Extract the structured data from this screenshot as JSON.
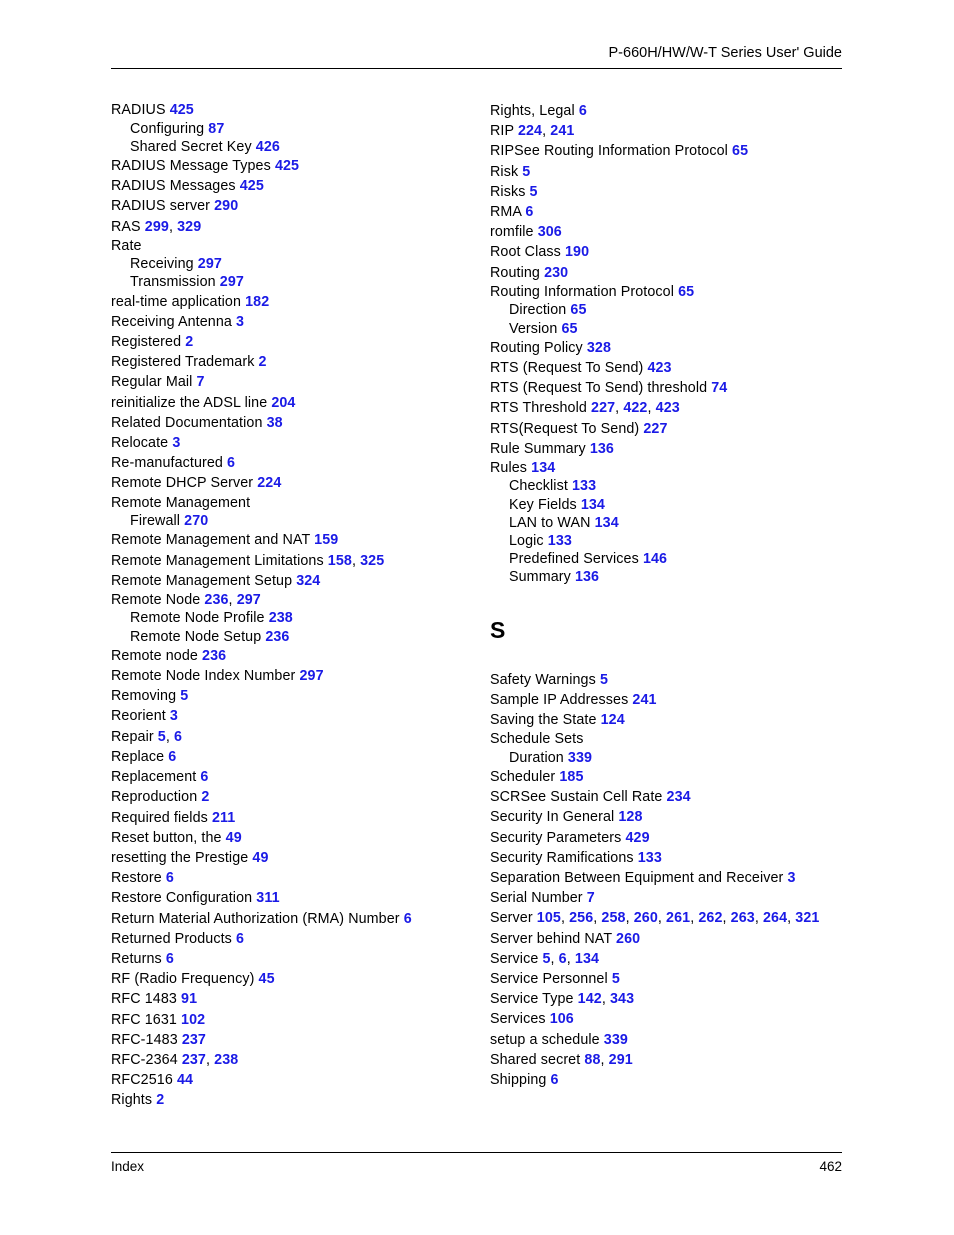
{
  "header": {
    "title": "P-660H/HW/W-T Series User' Guide"
  },
  "footer": {
    "label": "Index",
    "page_number": "462"
  },
  "colors": {
    "page_number_blue": "#1a1ae6",
    "text_black": "#000000"
  },
  "columns": {
    "left": [
      {
        "text": "RADIUS",
        "pages": [
          "425"
        ],
        "level": 0
      },
      {
        "text": "Configuring",
        "pages": [
          "87"
        ],
        "level": 1
      },
      {
        "text": "Shared Secret Key",
        "pages": [
          "426"
        ],
        "level": 1
      },
      {
        "text": "RADIUS Message Types",
        "pages": [
          "425"
        ],
        "level": 0
      },
      {
        "text": "RADIUS Messages",
        "pages": [
          "425"
        ],
        "level": 0
      },
      {
        "text": "RADIUS server",
        "pages": [
          "290"
        ],
        "level": 0
      },
      {
        "text": "RAS",
        "pages": [
          "299",
          "329"
        ],
        "level": 0
      },
      {
        "text": "Rate",
        "pages": [],
        "level": 0
      },
      {
        "text": "Receiving",
        "pages": [
          "297"
        ],
        "level": 1
      },
      {
        "text": "Transmission",
        "pages": [
          "297"
        ],
        "level": 1
      },
      {
        "text": "real-time application",
        "pages": [
          "182"
        ],
        "level": 0
      },
      {
        "text": "Receiving Antenna",
        "pages": [
          "3"
        ],
        "level": 0
      },
      {
        "text": "Registered",
        "pages": [
          "2"
        ],
        "level": 0
      },
      {
        "text": "Registered Trademark",
        "pages": [
          "2"
        ],
        "level": 0
      },
      {
        "text": "Regular Mail",
        "pages": [
          "7"
        ],
        "level": 0
      },
      {
        "text": "reinitialize the ADSL line",
        "pages": [
          "204"
        ],
        "level": 0
      },
      {
        "text": "Related Documentation",
        "pages": [
          "38"
        ],
        "level": 0
      },
      {
        "text": "Relocate",
        "pages": [
          "3"
        ],
        "level": 0
      },
      {
        "text": "Re-manufactured",
        "pages": [
          "6"
        ],
        "level": 0
      },
      {
        "text": "Remote DHCP Server",
        "pages": [
          "224"
        ],
        "level": 0
      },
      {
        "text": "Remote Management",
        "pages": [],
        "level": 0
      },
      {
        "text": "Firewall",
        "pages": [
          "270"
        ],
        "level": 1
      },
      {
        "text": "Remote Management and NAT",
        "pages": [
          "159"
        ],
        "level": 0
      },
      {
        "text": "Remote Management Limitations",
        "pages": [
          "158",
          "325"
        ],
        "level": 0
      },
      {
        "text": "Remote Management Setup",
        "pages": [
          "324"
        ],
        "level": 0
      },
      {
        "text": "Remote Node",
        "pages": [
          "236",
          "297"
        ],
        "level": 0
      },
      {
        "text": "Remote Node Profile",
        "pages": [
          "238"
        ],
        "level": 1
      },
      {
        "text": "Remote Node Setup",
        "pages": [
          "236"
        ],
        "level": 1
      },
      {
        "text": "Remote node",
        "pages": [
          "236"
        ],
        "level": 0
      },
      {
        "text": "Remote Node Index Number",
        "pages": [
          "297"
        ],
        "level": 0
      },
      {
        "text": "Removing",
        "pages": [
          "5"
        ],
        "level": 0
      },
      {
        "text": "Reorient",
        "pages": [
          "3"
        ],
        "level": 0
      },
      {
        "text": "Repair",
        "pages": [
          "5",
          "6"
        ],
        "level": 0
      },
      {
        "text": "Replace",
        "pages": [
          "6"
        ],
        "level": 0
      },
      {
        "text": "Replacement",
        "pages": [
          "6"
        ],
        "level": 0
      },
      {
        "text": "Reproduction",
        "pages": [
          "2"
        ],
        "level": 0
      },
      {
        "text": "Required fields",
        "pages": [
          "211"
        ],
        "level": 0
      },
      {
        "text": "Reset button, the",
        "pages": [
          "49"
        ],
        "level": 0
      },
      {
        "text": "resetting the Prestige",
        "pages": [
          "49"
        ],
        "level": 0
      },
      {
        "text": "Restore",
        "pages": [
          "6"
        ],
        "level": 0
      },
      {
        "text": "Restore Configuration",
        "pages": [
          "311"
        ],
        "level": 0
      },
      {
        "text": "Return Material Authorization (RMA) Number",
        "pages": [
          "6"
        ],
        "level": 0
      },
      {
        "text": "Returned Products",
        "pages": [
          "6"
        ],
        "level": 0
      },
      {
        "text": "Returns",
        "pages": [
          "6"
        ],
        "level": 0
      },
      {
        "text": "RF (Radio Frequency)",
        "pages": [
          "45"
        ],
        "level": 0
      },
      {
        "text": "RFC 1483",
        "pages": [
          "91"
        ],
        "level": 0
      },
      {
        "text": "RFC 1631",
        "pages": [
          "102"
        ],
        "level": 0
      },
      {
        "text": "RFC-1483",
        "pages": [
          "237"
        ],
        "level": 0
      },
      {
        "text": "RFC-2364",
        "pages": [
          "237",
          "238"
        ],
        "level": 0
      },
      {
        "text": "RFC2516",
        "pages": [
          "44"
        ],
        "level": 0
      },
      {
        "text": "Rights",
        "pages": [
          "2"
        ],
        "level": 0
      }
    ],
    "right_before_letter": [
      {
        "text": "Rights, Legal",
        "pages": [
          "6"
        ],
        "level": 0
      },
      {
        "text": "RIP",
        "pages": [
          "224",
          "241"
        ],
        "level": 0
      },
      {
        "text": "RIPSee Routing Information Protocol",
        "pages": [
          "65"
        ],
        "level": 0
      },
      {
        "text": "Risk",
        "pages": [
          "5"
        ],
        "level": 0
      },
      {
        "text": "Risks",
        "pages": [
          "5"
        ],
        "level": 0
      },
      {
        "text": "RMA",
        "pages": [
          "6"
        ],
        "level": 0
      },
      {
        "text": "romfile",
        "pages": [
          "306"
        ],
        "level": 0
      },
      {
        "text": "Root Class",
        "pages": [
          "190"
        ],
        "level": 0
      },
      {
        "text": "Routing",
        "pages": [
          "230"
        ],
        "level": 0
      },
      {
        "text": "Routing Information Protocol",
        "pages": [
          "65"
        ],
        "level": 0
      },
      {
        "text": "Direction",
        "pages": [
          "65"
        ],
        "level": 1
      },
      {
        "text": "Version",
        "pages": [
          "65"
        ],
        "level": 1
      },
      {
        "text": "Routing Policy",
        "pages": [
          "328"
        ],
        "level": 0
      },
      {
        "text": "RTS (Request To Send)",
        "pages": [
          "423"
        ],
        "level": 0
      },
      {
        "text": "RTS (Request To Send) threshold",
        "pages": [
          "74"
        ],
        "level": 0
      },
      {
        "text": "RTS Threshold",
        "pages": [
          "227",
          "422",
          "423"
        ],
        "level": 0
      },
      {
        "text": "RTS(Request To Send)",
        "pages": [
          "227"
        ],
        "level": 0
      },
      {
        "text": "Rule Summary",
        "pages": [
          "136"
        ],
        "level": 0
      },
      {
        "text": "Rules",
        "pages": [
          "134"
        ],
        "level": 0
      },
      {
        "text": "Checklist",
        "pages": [
          "133"
        ],
        "level": 1
      },
      {
        "text": "Key Fields",
        "pages": [
          "134"
        ],
        "level": 1
      },
      {
        "text": "LAN to WAN",
        "pages": [
          "134"
        ],
        "level": 1
      },
      {
        "text": "Logic",
        "pages": [
          "133"
        ],
        "level": 1
      },
      {
        "text": "Predefined Services",
        "pages": [
          "146"
        ],
        "level": 1
      },
      {
        "text": "Summary",
        "pages": [
          "136"
        ],
        "level": 1
      }
    ],
    "letter_heading": "S",
    "right_after_letter": [
      {
        "text": "Safety Warnings",
        "pages": [
          "5"
        ],
        "level": 0
      },
      {
        "text": "Sample IP Addresses",
        "pages": [
          "241"
        ],
        "level": 0
      },
      {
        "text": "Saving the State",
        "pages": [
          "124"
        ],
        "level": 0
      },
      {
        "text": "Schedule Sets",
        "pages": [],
        "level": 0
      },
      {
        "text": "Duration",
        "pages": [
          "339"
        ],
        "level": 1
      },
      {
        "text": "Scheduler",
        "pages": [
          "185"
        ],
        "level": 0
      },
      {
        "text": "SCRSee Sustain Cell Rate",
        "pages": [
          "234"
        ],
        "level": 0
      },
      {
        "text": "Security In General",
        "pages": [
          "128"
        ],
        "level": 0
      },
      {
        "text": "Security Parameters",
        "pages": [
          "429"
        ],
        "level": 0
      },
      {
        "text": "Security Ramifications",
        "pages": [
          "133"
        ],
        "level": 0
      },
      {
        "text": "Separation Between Equipment and Receiver",
        "pages": [
          "3"
        ],
        "level": 0
      },
      {
        "text": "Serial Number",
        "pages": [
          "7"
        ],
        "level": 0
      },
      {
        "text": "Server",
        "pages": [
          "105",
          "256",
          "258",
          "260",
          "261",
          "262",
          "263",
          "264",
          "321"
        ],
        "level": 0
      },
      {
        "text": "Server behind NAT",
        "pages": [
          "260"
        ],
        "level": 0
      },
      {
        "text": "Service",
        "pages": [
          "5",
          "6",
          "134"
        ],
        "level": 0
      },
      {
        "text": "Service Personnel",
        "pages": [
          "5"
        ],
        "level": 0
      },
      {
        "text": "Service Type",
        "pages": [
          "142",
          "343"
        ],
        "level": 0
      },
      {
        "text": "Services",
        "pages": [
          "106"
        ],
        "level": 0
      },
      {
        "text": "setup a schedule",
        "pages": [
          "339"
        ],
        "level": 0
      },
      {
        "text": "Shared secret",
        "pages": [
          "88",
          "291"
        ],
        "level": 0
      },
      {
        "text": "Shipping",
        "pages": [
          "6"
        ],
        "level": 0
      }
    ]
  }
}
